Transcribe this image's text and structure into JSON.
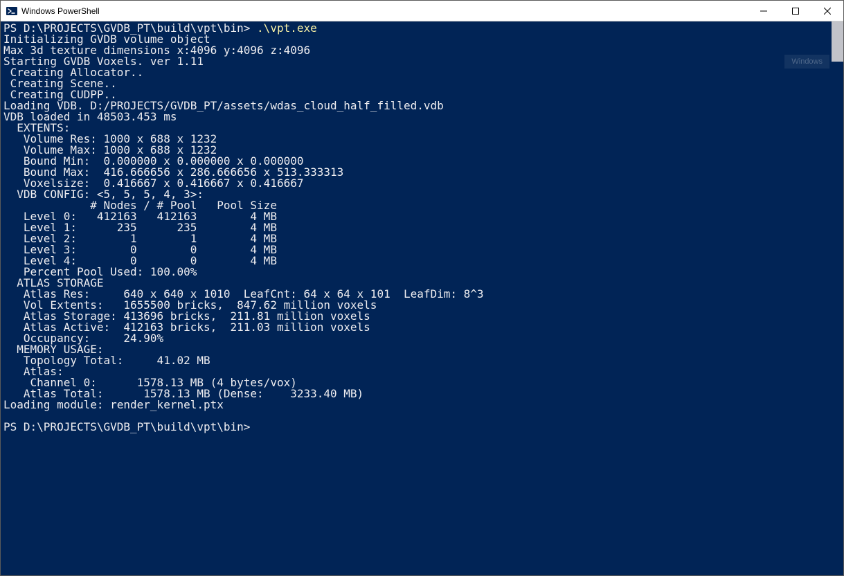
{
  "window": {
    "title": "Windows PowerShell"
  },
  "ghost": "Windows",
  "prompt1_prefix": "PS D:\\PROJECTS\\GVDB_PT\\build\\vpt\\bin> ",
  "prompt1_cmd": ".\\vpt.exe",
  "lines": {
    "l01": "Initializing GVDB volume object",
    "l02": "Max 3d texture dimensions x:4096 y:4096 z:4096",
    "l03": "Starting GVDB Voxels. ver 1.11",
    "l04": " Creating Allocator..",
    "l05": " Creating Scene..",
    "l06": " Creating CUDPP..",
    "l07": "Loading VDB. D:/PROJECTS/GVDB_PT/assets/wdas_cloud_half_filled.vdb",
    "l08": "VDB loaded in 48503.453 ms",
    "l09": "  EXTENTS:",
    "l10": "   Volume Res: 1000 x 688 x 1232",
    "l11": "   Volume Max: 1000 x 688 x 1232",
    "l12": "   Bound Min:  0.000000 x 0.000000 x 0.000000",
    "l13": "   Bound Max:  416.666656 x 286.666656 x 513.333313",
    "l14": "   Voxelsize:  0.416667 x 0.416667 x 0.416667",
    "l15": "  VDB CONFIG: <5, 5, 5, 4, 3>:",
    "l16": "             # Nodes / # Pool   Pool Size",
    "l17": "   Level 0:   412163   412163        4 MB",
    "l18": "   Level 1:      235      235        4 MB",
    "l19": "   Level 2:        1        1        4 MB",
    "l20": "   Level 3:        0        0        4 MB",
    "l21": "   Level 4:        0        0        4 MB",
    "l22": "   Percent Pool Used: 100.00%",
    "l23": "  ATLAS STORAGE",
    "l24": "   Atlas Res:     640 x 640 x 1010  LeafCnt: 64 x 64 x 101  LeafDim: 8^3",
    "l25": "   Vol Extents:   1655500 bricks,  847.62 million voxels",
    "l26": "   Atlas Storage: 413696 bricks,  211.81 million voxels",
    "l27": "   Atlas Active:  412163 bricks,  211.03 million voxels",
    "l28": "   Occupancy:     24.90%",
    "l29": "  MEMORY USAGE:",
    "l30": "   Topology Total:     41.02 MB",
    "l31": "   Atlas:",
    "l32": "    Channel 0:      1578.13 MB (4 bytes/vox)",
    "l33": "   Atlas Total:      1578.13 MB (Dense:    3233.40 MB)",
    "l34": "Loading module: render_kernel.ptx"
  },
  "prompt2": "PS D:\\PROJECTS\\GVDB_PT\\build\\vpt\\bin>"
}
